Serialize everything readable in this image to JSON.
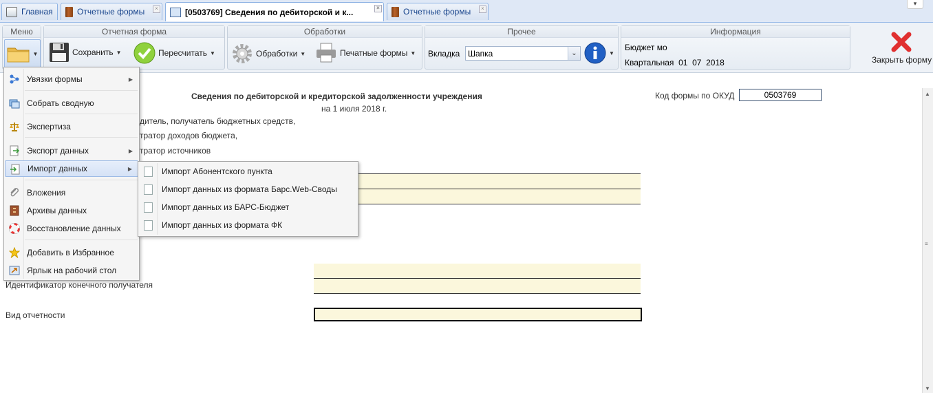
{
  "tabs": [
    {
      "label": "Главная",
      "icon": "home-icon"
    },
    {
      "label": "Отчетные формы",
      "icon": "book-icon",
      "closable": true
    },
    {
      "label": "[0503769] Сведения по дебиторской и к...",
      "icon": "form-icon",
      "closable": true,
      "active": true
    },
    {
      "label": "Отчетные формы",
      "icon": "book-icon",
      "closable": true
    }
  ],
  "toolbar": {
    "menu_title": "Меню",
    "report_form_title": "Отчетная форма",
    "save_label": "Сохранить",
    "recalc_label": "Пересчитать",
    "processing_title": "Обработки",
    "processing_label": "Обработки",
    "print_label": "Печатные формы",
    "other_title": "Прочее",
    "tab_label": "Вкладка",
    "tab_value": "Шапка",
    "info_title": "Информация",
    "info_line1": "Бюджет мо",
    "info_line2": "Квартальная  01  07  2018",
    "close_label": "Закрыть форму"
  },
  "document": {
    "title": "Сведения по дебиторской и кредиторской задолженности учреждения",
    "subtitle": "на 1 июля 2018 г.",
    "okud_label": "Код формы по ОКУД",
    "okud_value": "0503769",
    "partial_labels": [
      "дитель, получатель бюджетных средств,",
      "тратор доходов бюджета,",
      "тратор источников"
    ],
    "final_recipient_label": "Идентификатор конечного получателя",
    "report_type_label": "Вид отчетности"
  },
  "main_menu": {
    "items": [
      {
        "label": "Увязки формы",
        "icon": "links-icon",
        "submenu": true
      },
      {
        "label": "Собрать сводную",
        "icon": "consolidate-icon"
      },
      {
        "label": "Экспертиза",
        "icon": "scales-icon"
      },
      {
        "label": "Экспорт данных",
        "icon": "export-icon",
        "submenu": true
      },
      {
        "label": "Импорт данных",
        "icon": "import-icon",
        "submenu": true,
        "highlighted": true
      },
      {
        "label": "Вложения",
        "icon": "paperclip-icon"
      },
      {
        "label": "Архивы данных",
        "icon": "archive-icon"
      },
      {
        "label": "Восстановление данных",
        "icon": "lifebuoy-icon"
      },
      {
        "label": "Добавить в Избранное",
        "icon": "star-icon"
      },
      {
        "label": "Ярлык на рабочий стол",
        "icon": "shortcut-icon"
      }
    ]
  },
  "import_submenu": {
    "items": [
      {
        "label": "Импорт Абонентского пункта"
      },
      {
        "label": "Импорт данных из формата Барс.Web-Своды"
      },
      {
        "label": "Импорт данных из БАРС-Бюджет"
      },
      {
        "label": "Импорт данных из формата ФК"
      }
    ]
  },
  "colors": {
    "field_bg": "#fbf7dc",
    "tab_border": "#8db2e3",
    "menu_highlight": "#d5e2f6",
    "close_red": "#e03030"
  }
}
